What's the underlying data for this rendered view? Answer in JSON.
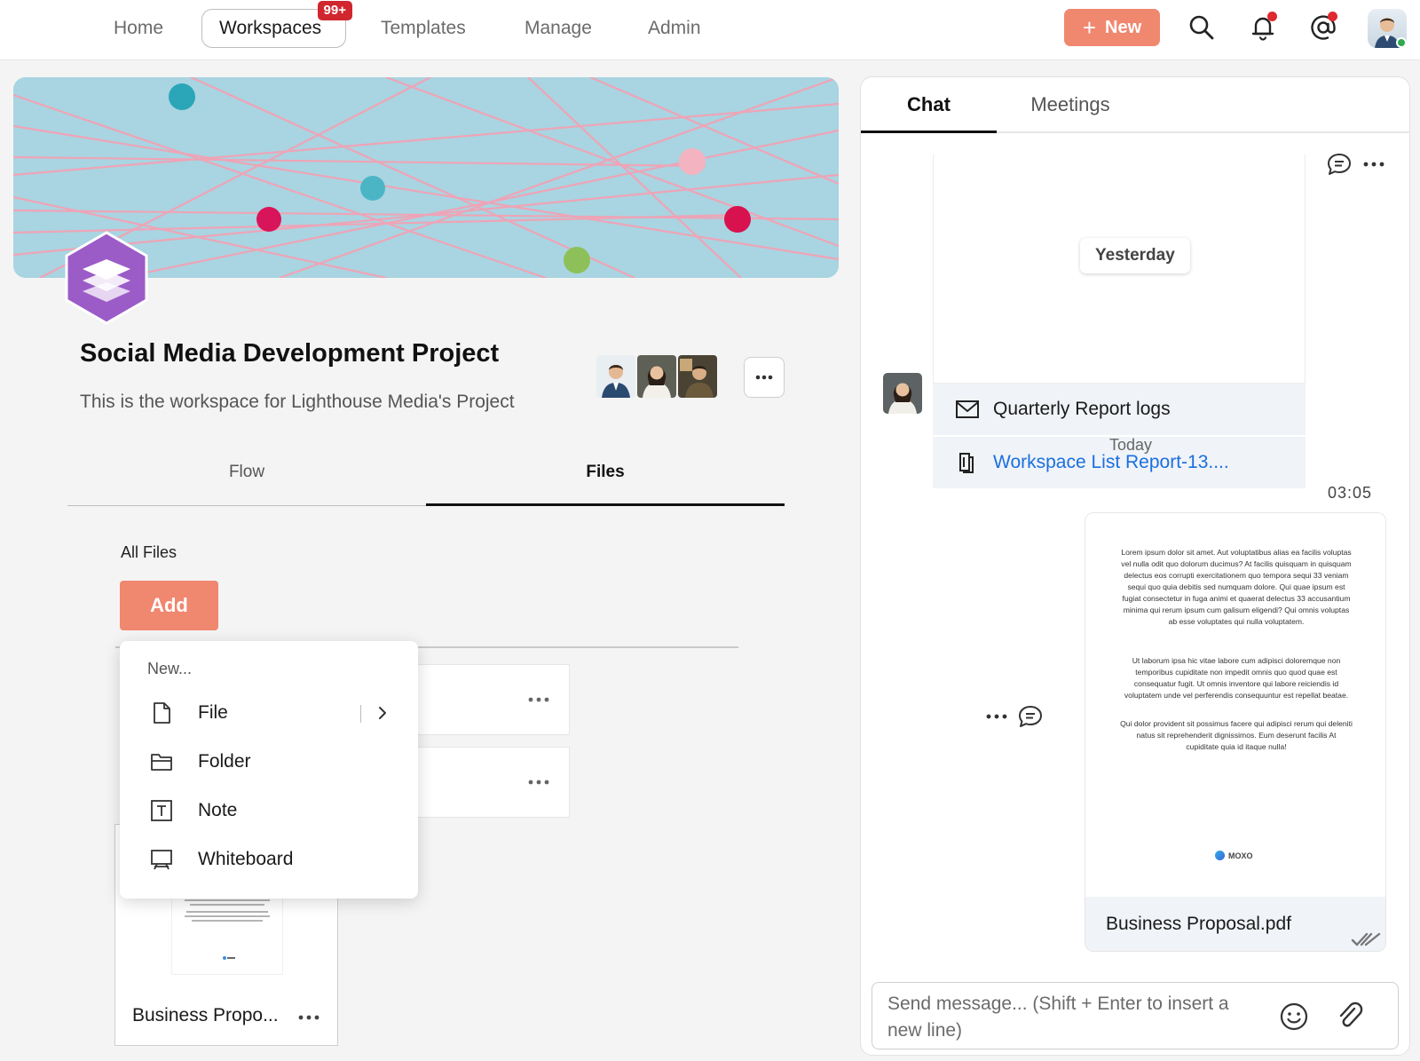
{
  "nav": {
    "tabs": [
      {
        "label": "Home"
      },
      {
        "label": "Workspaces",
        "badge": "99+"
      },
      {
        "label": "Templates"
      },
      {
        "label": "Manage"
      },
      {
        "label": "Admin"
      }
    ],
    "new_label": "New",
    "icons": [
      "search-icon",
      "bell-icon",
      "mention-icon"
    ]
  },
  "workspace": {
    "title": "Social Media Development Project",
    "description": "This is the workspace for Lighthouse Media's Project",
    "tabs": [
      "Flow",
      "Files"
    ],
    "active_tab": "Files"
  },
  "files": {
    "section_label": "All Files",
    "add_label": "Add",
    "card_name": "Business Propo..."
  },
  "dropdown": {
    "header": "New...",
    "items": [
      {
        "label": "File",
        "icon": "file-icon"
      },
      {
        "label": "Folder",
        "icon": "folder-icon"
      },
      {
        "label": "Note",
        "icon": "note-icon"
      },
      {
        "label": "Whiteboard",
        "icon": "whiteboard-icon"
      }
    ]
  },
  "chat": {
    "tabs": [
      "Chat",
      "Meetings"
    ],
    "active_tab": "Chat",
    "yesterday_label": "Yesterday",
    "email_subject": "Quarterly Report logs",
    "file_link": "Workspace List Report-13....",
    "today_label": "Today",
    "message_time": "03:05",
    "attachment": {
      "file_name": "Business Proposal.pdf",
      "preview_paragraphs": [
        "Lorem ipsum dolor sit amet. Aut voluptatibus alias ea facilis voluptas vel nulla odit quo dolorum ducimus? At facilis quisquam in quisquam delectus eos corrupti exercitationem quo tempora sequi 33 veniam sequi quo quia debitis sed numquam dolore. Qui quae ipsum est fugiat consectetur in fuga animi et quaerat delectus 33 accusantium minima qui rerum ipsum cum galisum eligendi? Qui omnis voluptas ab esse voluptates qui nulla voluptatem.",
        "Ut laborum ipsa hic vitae labore cum adipisci doloremque non temporibus cupiditate non impedit omnis quo quod quae est consequatur fugit. Ut omnis inventore qui labore reiciendis id voluptatem unde vel perferendis consequuntur est repellat beatae.",
        "Qui dolor provident sit possimus facere qui adipisci rerum qui deleniti natus sit reprehenderit dignissimos. Eum deserunt facilis At cupiditate quia id itaque nulla!"
      ],
      "brand": "MOXO"
    },
    "composer_placeholder": "Send message... (Shift + Enter to insert a new line)"
  },
  "colors": {
    "accent": "#f0876f",
    "badge": "#d0262e",
    "link": "#1b6fe0",
    "logo_purple": "#9b5cc7"
  }
}
